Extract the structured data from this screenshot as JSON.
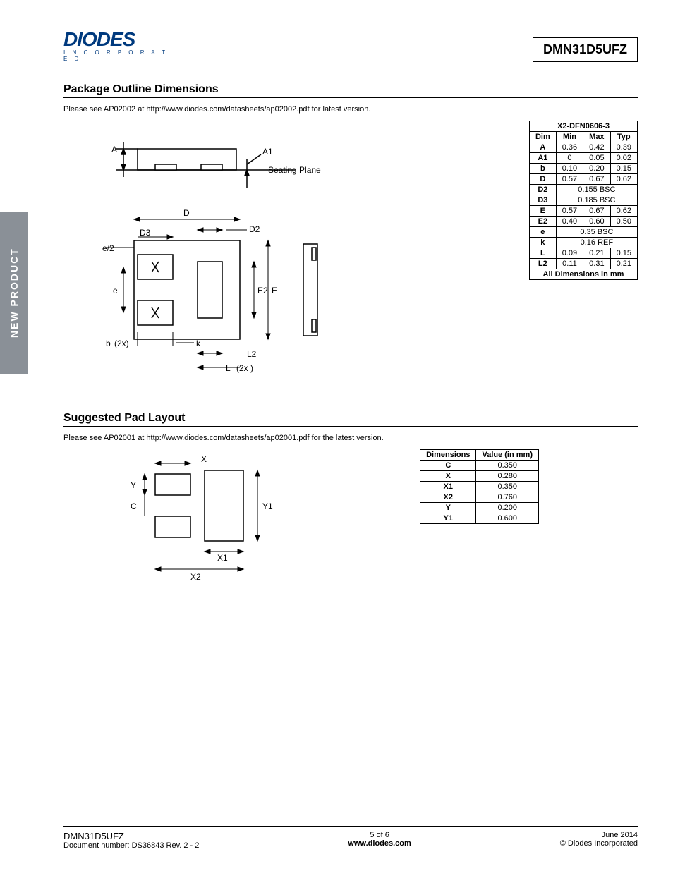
{
  "sideTab": "NEW PRODUCT",
  "logo": {
    "brand": "DIODES",
    "sub": "I N C O R P O R A T E D"
  },
  "partNumber": "DMN31D5UFZ",
  "section1": {
    "title": "Package Outline Dimensions",
    "note": "Please see AP02002 at http://www.diodes.com/datasheets/ap02002.pdf for latest version.",
    "tableTitle": "X2-DFN0606-3",
    "tableHeaders": [
      "Dim",
      "Min",
      "Max",
      "Typ"
    ],
    "rows": [
      {
        "dim": "A",
        "min": "0.36",
        "max": "0.42",
        "typ": "0.39"
      },
      {
        "dim": "A1",
        "min": "0",
        "max": "0.05",
        "typ": "0.02"
      },
      {
        "dim": "b",
        "min": "0.10",
        "max": "0.20",
        "typ": "0.15"
      },
      {
        "dim": "D",
        "min": "0.57",
        "max": "0.67",
        "typ": "0.62"
      },
      {
        "dim": "D2",
        "span": "0.155 BSC"
      },
      {
        "dim": "D3",
        "span": "0.185 BSC"
      },
      {
        "dim": "E",
        "min": "0.57",
        "max": "0.67",
        "typ": "0.62"
      },
      {
        "dim": "E2",
        "min": "0.40",
        "max": "0.60",
        "typ": "0.50"
      },
      {
        "dim": "e",
        "span": "0.35 BSC"
      },
      {
        "dim": "k",
        "span": "0.16 REF"
      },
      {
        "dim": "L",
        "min": "0.09",
        "max": "0.21",
        "typ": "0.15"
      },
      {
        "dim": "L2",
        "min": "0.11",
        "max": "0.31",
        "typ": "0.21"
      }
    ],
    "tableFooter": "All Dimensions in mm",
    "diagramLabels": {
      "A": "A",
      "A1": "A1",
      "seating": "Seating Plane",
      "D": "D",
      "D2": "D2",
      "D3": "D3",
      "e2": "e/2",
      "e": "e",
      "E": "E",
      "E2": "E2",
      "b": "b",
      "bx": "(2x)",
      "k": "k",
      "L": "L",
      "Lx": "(2x )",
      "L2": "L2"
    }
  },
  "section2": {
    "title": "Suggested Pad Layout",
    "note": "Please see AP02001 at http://www.diodes.com/datasheets/ap02001.pdf for the latest version.",
    "headers": [
      "Dimensions",
      "Value (in mm)"
    ],
    "rows": [
      {
        "dim": "C",
        "val": "0.350"
      },
      {
        "dim": "X",
        "val": "0.280"
      },
      {
        "dim": "X1",
        "val": "0.350"
      },
      {
        "dim": "X2",
        "val": "0.760"
      },
      {
        "dim": "Y",
        "val": "0.200"
      },
      {
        "dim": "Y1",
        "val": "0.600"
      }
    ],
    "diagramLabels": {
      "X": "X",
      "Y": "Y",
      "C": "C",
      "Y1": "Y1",
      "X1": "X1",
      "X2": "X2"
    }
  },
  "footer": {
    "leftLine1": "DMN31D5UFZ",
    "leftLine2": "Document number: DS36843  Rev. 2 - 2",
    "midLine1": "5 of 6",
    "midLine2": "www.diodes.com",
    "rightLine1": "June 2014",
    "rightLine2": "© Diodes Incorporated"
  }
}
